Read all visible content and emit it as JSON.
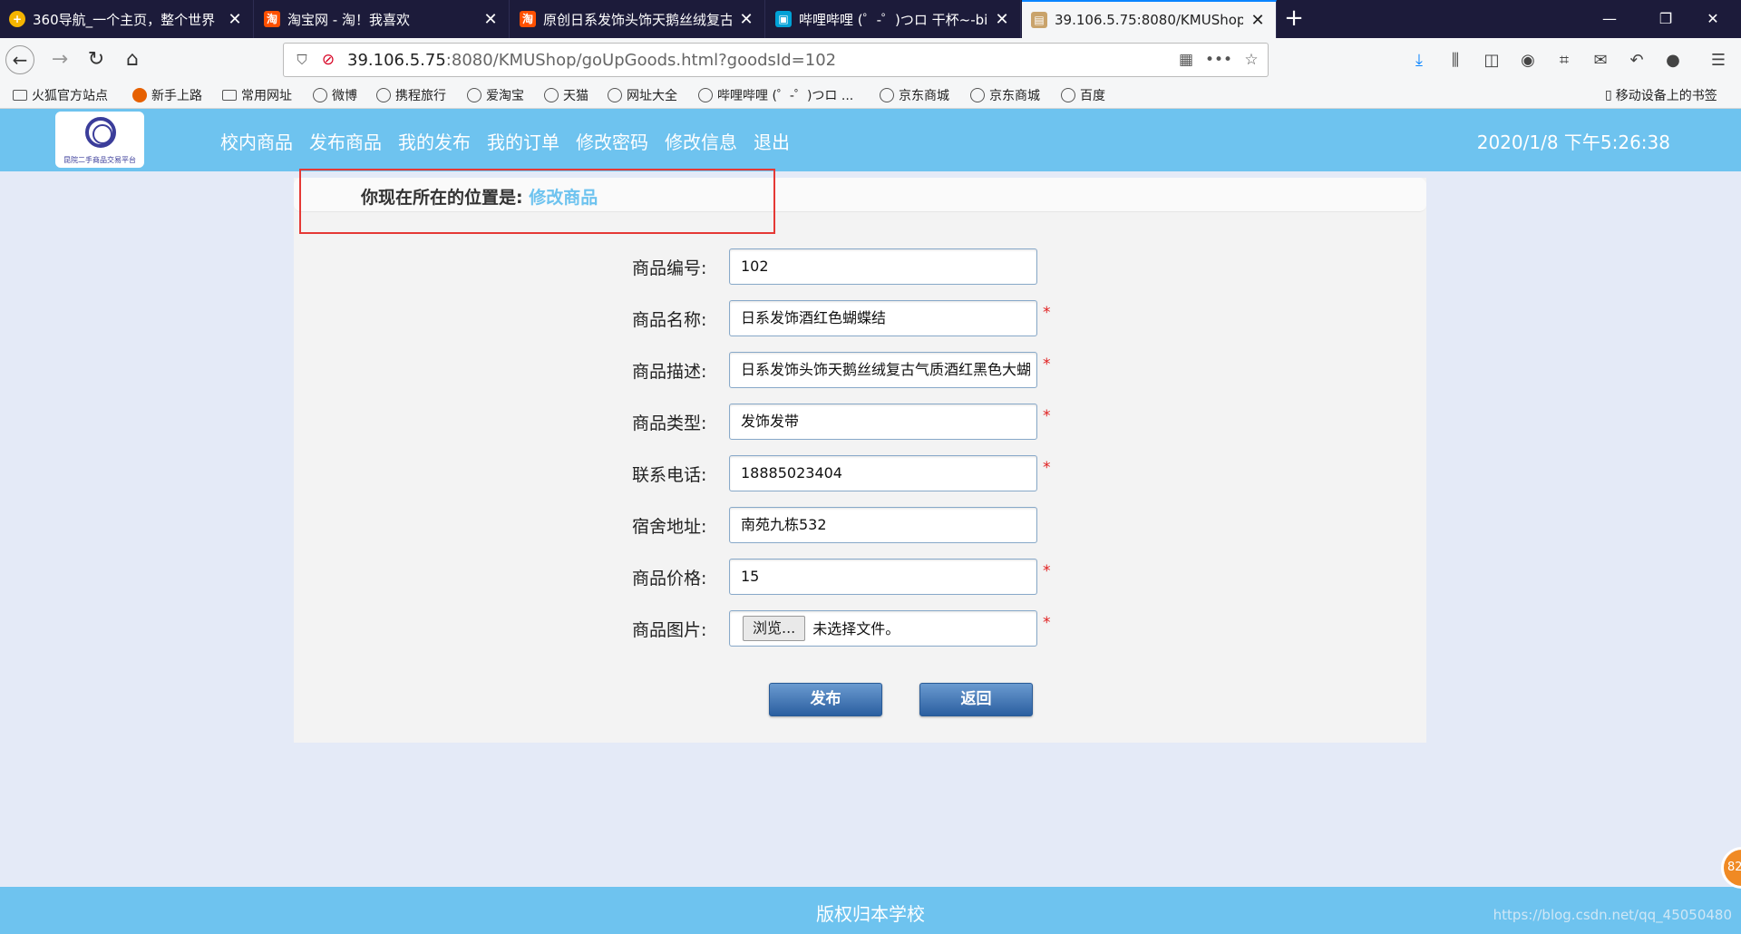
{
  "tabs": [
    {
      "label": "360导航_一个主页，整个世界",
      "icon": "360-icon",
      "color": "#f4b400"
    },
    {
      "label": "淘宝网 - 淘！我喜欢",
      "icon": "taobao-icon",
      "color": "#ff5000"
    },
    {
      "label": "原创日系发饰头饰天鹅丝绒复古",
      "icon": "taobao-icon",
      "color": "#ff5000"
    },
    {
      "label": "哔哩哔哩 (゜-゜)つロ 干杯~-bi",
      "icon": "bilibili-icon",
      "color": "#00a1d6"
    },
    {
      "label": "39.106.5.75:8080/KMUShop/",
      "icon": "page-icon",
      "color": "#c9a36b"
    }
  ],
  "address": {
    "host": "39.106.5.75",
    "rest": ":8080/KMUShop/goUpGoods.html?goodsId=102"
  },
  "bookmarks": [
    {
      "label": "火狐官方站点",
      "icon": "folder-icon"
    },
    {
      "label": "新手上路",
      "icon": "firefox-icon"
    },
    {
      "label": "常用网址",
      "icon": "folder-icon"
    },
    {
      "label": "微博",
      "icon": "globe-icon"
    },
    {
      "label": "携程旅行",
      "icon": "globe-icon"
    },
    {
      "label": "爱淘宝",
      "icon": "globe-icon"
    },
    {
      "label": "天猫",
      "icon": "globe-icon"
    },
    {
      "label": "网址大全",
      "icon": "globe-icon"
    },
    {
      "label": "哔哩哔哩 (゜-゜)つロ ...",
      "icon": "globe-icon"
    },
    {
      "label": "京东商城",
      "icon": "globe-icon"
    },
    {
      "label": "京东商城",
      "icon": "globe-icon"
    },
    {
      "label": "百度",
      "icon": "globe-icon"
    }
  ],
  "mobile_bookmarks": "移动设备上的书签",
  "site": {
    "logo_text": "昆院二手商品交易平台",
    "menu": [
      "校内商品",
      "发布商品",
      "我的发布",
      "我的订单",
      "修改密码",
      "修改信息",
      "退出"
    ],
    "clock": "2020/1/8 下午5:26:38"
  },
  "breadcrumb": {
    "prefix": "你现在所在的位置是:",
    "current": "修改商品"
  },
  "form": {
    "fields": [
      {
        "label": "商品编号:",
        "value": "102",
        "required": false
      },
      {
        "label": "商品名称:",
        "value": "日系发饰酒红色蝴蝶结",
        "required": true
      },
      {
        "label": "商品描述:",
        "value": "日系发饰头饰天鹅丝绒复古气质酒红黑色大蝴",
        "required": true
      },
      {
        "label": "商品类型:",
        "value": "发饰发带",
        "required": true
      },
      {
        "label": "联系电话:",
        "value": "18885023404",
        "required": true
      },
      {
        "label": "宿舍地址:",
        "value": "南苑九栋532",
        "required": false
      },
      {
        "label": "商品价格:",
        "value": "15",
        "required": true
      },
      {
        "label": "商品图片:",
        "required": true
      }
    ],
    "file_button": "浏览...",
    "file_status": "未选择文件。",
    "required_mark": "*",
    "publish": "发布",
    "back": "返回"
  },
  "footer": "版权归本学校",
  "watermark": "https://blog.csdn.net/qq_45050480",
  "badge": "82"
}
